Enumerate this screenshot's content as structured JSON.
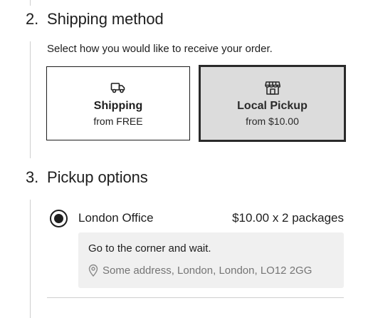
{
  "shipping_section": {
    "number": "2.",
    "title": "Shipping method",
    "description": "Select how you would like to receive your order.",
    "options": [
      {
        "id": "shipping",
        "icon": "truck-icon",
        "title": "Shipping",
        "subtitle": "from FREE",
        "selected": false
      },
      {
        "id": "local-pickup",
        "icon": "store-icon",
        "title": "Local Pickup",
        "subtitle": "from $10.00",
        "selected": true
      }
    ]
  },
  "pickup_section": {
    "number": "3.",
    "title": "Pickup options",
    "location": {
      "name": "London Office",
      "price": "$10.00 x 2 packages",
      "selected": true,
      "instructions": "Go to the corner and wait.",
      "address": "Some address, London, London, LO12 2GG",
      "address_icon": "map-pin-icon"
    }
  },
  "colors": {
    "text": "#1e1e1e",
    "muted": "#757575",
    "selected_card_bg": "#dcdcdc",
    "details_bg": "#f0f0f0",
    "rule": "#cfcfcf"
  }
}
